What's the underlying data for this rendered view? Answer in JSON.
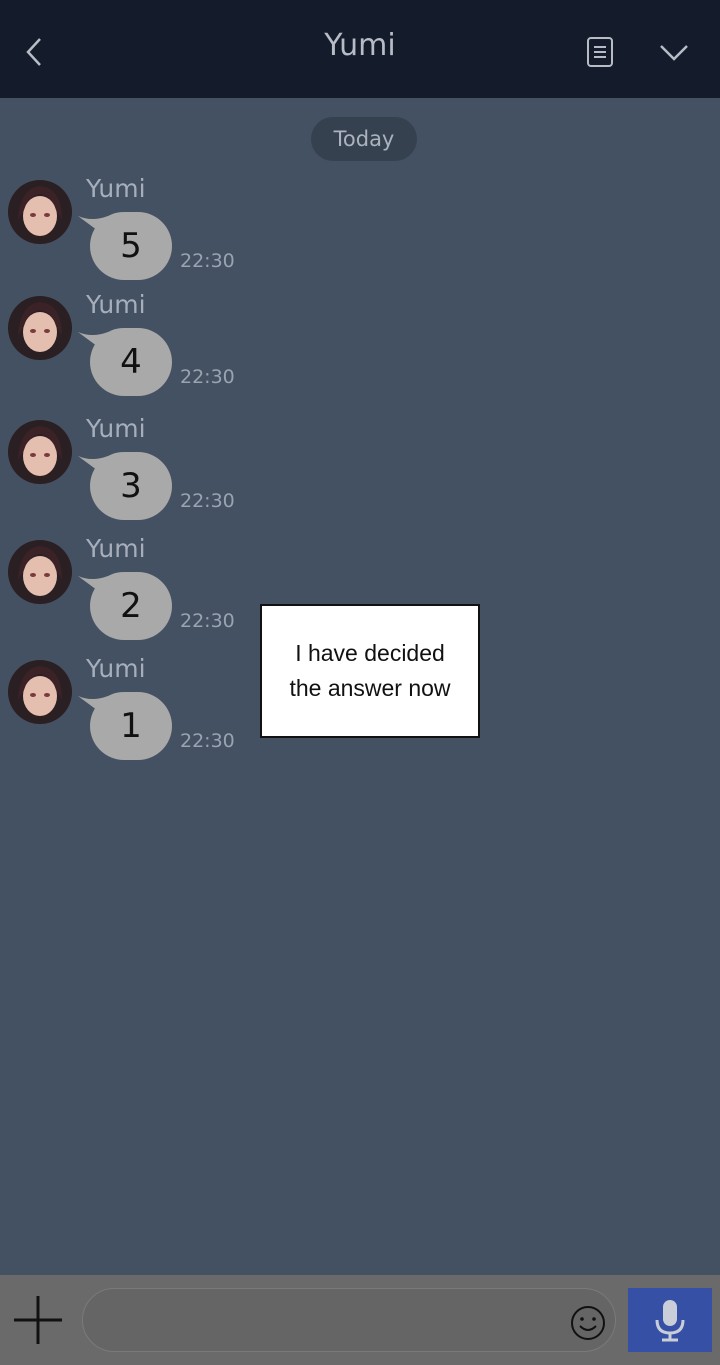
{
  "header": {
    "title": "Yumi"
  },
  "date_separator": "Today",
  "messages": [
    {
      "sender": "Yumi",
      "text": "5",
      "time": "22:30"
    },
    {
      "sender": "Yumi",
      "text": "4",
      "time": "22:30"
    },
    {
      "sender": "Yumi",
      "text": "3",
      "time": "22:30"
    },
    {
      "sender": "Yumi",
      "text": "2",
      "time": "22:30"
    },
    {
      "sender": "Yumi",
      "text": "1",
      "time": "22:30"
    }
  ],
  "caption": {
    "line1": "I have decided",
    "line2": "the answer now"
  },
  "composer": {
    "value": "",
    "placeholder": ""
  },
  "icons": {
    "back": "back-chevron-icon",
    "notes": "notes-icon",
    "menu": "chevron-down-icon",
    "add": "plus-icon",
    "emoji": "smiley-icon",
    "voice": "microphone-icon"
  },
  "colors": {
    "header_bg": "#141b2b",
    "chat_bg": "#445162",
    "bubble": "#a9a9a9",
    "mic_button": "#3650a5"
  }
}
